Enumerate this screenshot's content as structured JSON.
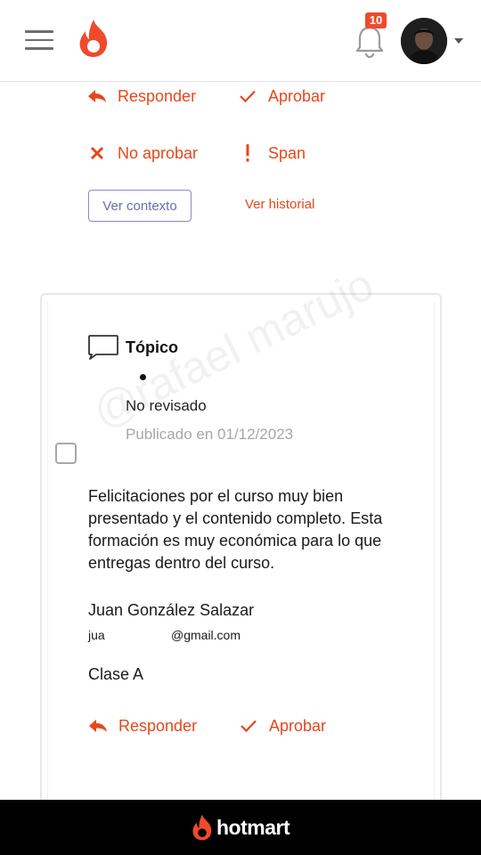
{
  "header": {
    "menu_icon": "hamburger-menu-icon",
    "logo_icon": "hotmart-flame-icon",
    "notifications": {
      "icon": "bell-icon",
      "count": "10"
    },
    "avatar_icon": "user-avatar",
    "accent_color": "#ef4a2b"
  },
  "top_actions": {
    "reply": {
      "label": "Responder",
      "icon": "reply-arrow-icon"
    },
    "approve": {
      "label": "Aprobar",
      "icon": "checkmark-icon"
    },
    "reject": {
      "label": "No aprobar",
      "icon": "close-x-icon"
    },
    "spam": {
      "label": "Span",
      "icon": "exclamation-icon"
    },
    "view_context": "Ver contexto",
    "view_history": "Ver historial"
  },
  "comment": {
    "type_label": "Tópico",
    "status": "No revisado",
    "published": "Publicado en 01/12/2023",
    "body": "Felicitaciones por el curso muy bien presentado y el contenido completo. Esta formación es muy económica para lo que entregas dentro del curso.",
    "author_name": "Juan González Salazar",
    "email_prefix": "jua",
    "email_suffix": "@gmail.com",
    "class_name": "Clase A",
    "actions": {
      "reply": "Responder",
      "approve": "Aprobar"
    }
  },
  "watermark": "@rafael marujo",
  "footer": {
    "brand": "hotmart"
  }
}
